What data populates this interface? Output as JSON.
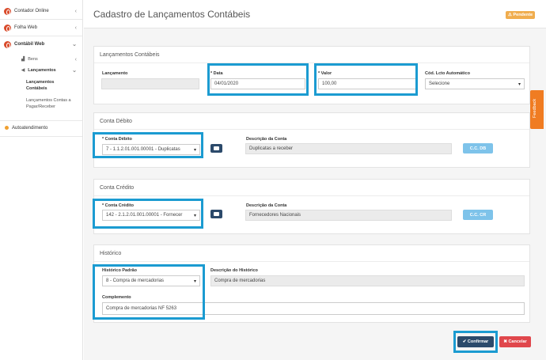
{
  "sidebar": {
    "items": [
      {
        "label": "Contador Online"
      },
      {
        "label": "Folha Web"
      },
      {
        "label": "Contábil Web"
      },
      {
        "label": "Bens"
      },
      {
        "label": "Lançamentos"
      },
      {
        "label": "Lançamentos Contábeis"
      },
      {
        "label": "Lançamentos Contas a Pagar/Receber"
      },
      {
        "label": "Autoatendimento"
      }
    ]
  },
  "header": {
    "title": "Cadastro de Lançamentos Contábeis",
    "status_badge": "Pendente"
  },
  "feedback": {
    "label": "Feedback"
  },
  "lancamentos": {
    "title": "Lançamentos Contábeis",
    "lancamento_label": "Lançamento",
    "lancamento_value": "",
    "data_label": "* Data",
    "data_value": "04/01/2020",
    "valor_label": "* Valor",
    "valor_value": "100,00",
    "cod_label": "Cód. Lcto Automático",
    "cod_value": "Selecione"
  },
  "debito": {
    "title": "Conta Débito",
    "conta_label": "* Conta Débito",
    "conta_value": "7 - 1.1.2.01.001.00001 - Duplicatas",
    "desc_label": "Descrição da Conta",
    "desc_value": "Duplicatas a receber",
    "cc_label": "C.C. DB"
  },
  "credito": {
    "title": "Conta Crédito",
    "conta_label": "* Conta Crédito",
    "conta_value": "142 - 2.1.2.01.001.00001 - Fornecer",
    "desc_label": "Descrição da Conta",
    "desc_value": "Fornecedores Nacionais",
    "cc_label": "C.C. CR"
  },
  "historico": {
    "title": "Histórico",
    "padrao_label": "Histórico Padrão",
    "padrao_value": "8 - Compra de mercadorias",
    "desc_label": "Descrição do Histórico",
    "desc_value": "Compra de mercadorias",
    "complemento_label": "Complemento",
    "complemento_value": "Compra de mercadorias NF 5263"
  },
  "actions": {
    "confirm_label": "✔ Confirmar",
    "cancel_label": "✖ Cancelar"
  },
  "colors": {
    "highlight": "#1b9bd1",
    "primary": "#2c4a6b",
    "danger": "#e0474c",
    "badge": "#f0ad4e",
    "feedback": "#f07c22"
  }
}
